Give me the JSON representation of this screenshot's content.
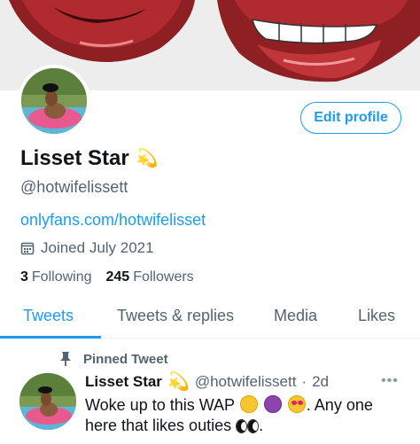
{
  "banner": {
    "icon": "lips-artwork"
  },
  "profile": {
    "name": "Lisset Star",
    "name_emoji": "💫",
    "handle": "@hotwifelissett",
    "link": "onlyfans.com/hotwifelisset",
    "joined": "Joined July 2021",
    "following_count": "3",
    "following_label": "Following",
    "followers_count": "245",
    "followers_label": "Followers"
  },
  "edit_button": {
    "label": "Edit profile"
  },
  "tabs": [
    {
      "label": "Tweets",
      "active": true
    },
    {
      "label": "Tweets & replies",
      "active": false
    },
    {
      "label": "Media",
      "active": false
    },
    {
      "label": "Likes",
      "active": false
    }
  ],
  "pinned_tweet": {
    "pinned_label": "Pinned Tweet",
    "author_name": "Lisset Star",
    "author_emoji": "💫",
    "author_handle": "@hotwifelissett",
    "separator": "·",
    "time": "2d",
    "more": "•••",
    "text_part1": "Woke up to this WAP",
    "text_part2": ".  Any one",
    "text_part3": "here that likes outies",
    "text_part4": "."
  },
  "colors": {
    "accent": "#1d9bf0",
    "muted": "#536471",
    "text": "#0f1419"
  }
}
